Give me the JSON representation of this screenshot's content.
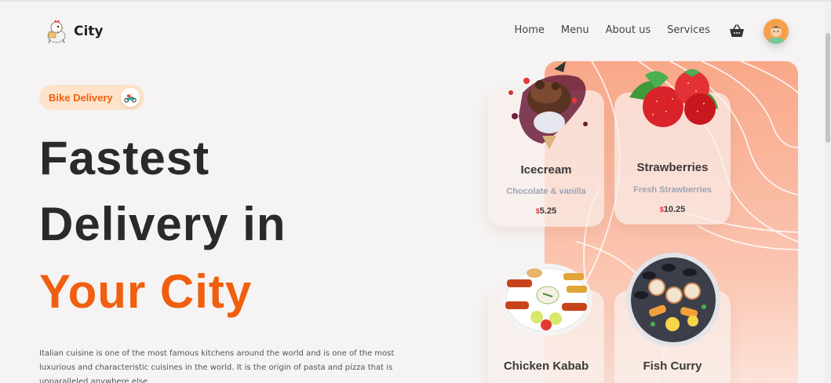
{
  "brand": {
    "name": "City",
    "logo_icon": "rooster-delivery-icon"
  },
  "nav": {
    "items": [
      "Home",
      "Menu",
      "About us",
      "Services"
    ],
    "cart_icon": "basket-icon",
    "avatar_icon": "user-avatar"
  },
  "hero": {
    "badge": {
      "label": "Bike Delivery",
      "icon": "scooter-icon"
    },
    "title_line1": "Fastest",
    "title_line2": "Delivery in",
    "title_line3": "Your City",
    "description": "Italian cuisine is one of the most famous kitchens around the world and is one of the most luxurious and characteristic cuisines in the world. It is the origin of pasta and pizza that is unparalleled anywhere else."
  },
  "cards": [
    {
      "name": "Icecream",
      "subtitle": "Chocolate & vanilla",
      "currency": "$",
      "price": "5.25",
      "image_icon": "icecream-image"
    },
    {
      "name": "Strawberries",
      "subtitle": "Fresh Strawberries",
      "currency": "$",
      "price": "10.25",
      "image_icon": "strawberries-image"
    },
    {
      "name": "Chicken Kabab",
      "image_icon": "chicken-kabab-image"
    },
    {
      "name": "Fish Curry",
      "image_icon": "fish-curry-image"
    }
  ],
  "colors": {
    "accent": "#ef5f0f",
    "badge_bg": "#fde3c9",
    "panel": "#f9a889",
    "background": "#f5f3f3"
  }
}
